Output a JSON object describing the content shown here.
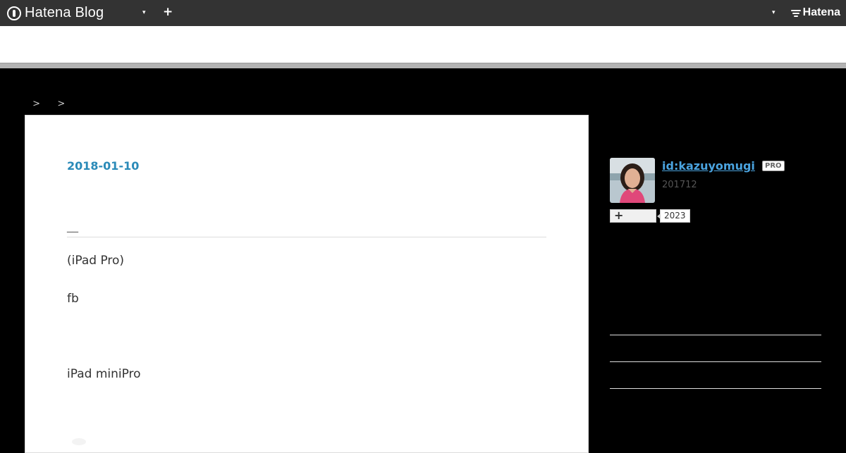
{
  "topbar": {
    "brand": "Hatena Blog",
    "caret_icon": "▾",
    "plus_icon": "+",
    "hatena_logo": "Hatena"
  },
  "breadcrumb": {
    "item1": " ",
    "item2": "   ",
    "separator": ">"
  },
  "article": {
    "date": "2018-01-10",
    "title": "__",
    "paragraphs": [
      "(iPad Pro)",
      "fb",
      "iPad miniPro"
    ]
  },
  "sidebar": {
    "username": "id:kazuyomugi",
    "badge": "PRO",
    "since": "201712",
    "follow_icon": "+",
    "follow_count": "2023"
  },
  "colors": {
    "topbar": "#333333",
    "background": "#000000",
    "accent": "#2a8ab8",
    "link": "#4aa3df"
  }
}
